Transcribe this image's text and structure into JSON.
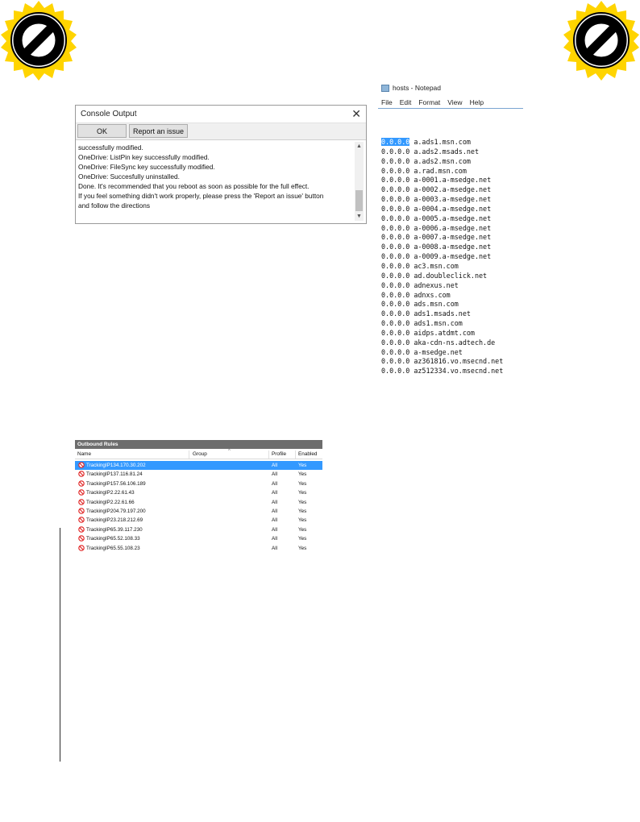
{
  "console": {
    "title": "Console Output",
    "close_label": "✕",
    "ok_label": "OK",
    "report_label": "Report an issue",
    "log": [
      "successfully modified.",
      "OneDrive: ListPin key successfully modified.",
      "OneDrive: FileSync key successfully modified.",
      "OneDrive: Succesfully uninstalled.",
      "Done. It's recommended that you reboot as soon as possible for the full effect.",
      "If you feel something didn't work properly, please press the 'Report an issue' button",
      "and follow the directions"
    ]
  },
  "notepad": {
    "title": "hosts - Notepad",
    "menu": [
      "File",
      "Edit",
      "Format",
      "View",
      "Help"
    ],
    "selected_ip": "0.0.0.0",
    "first_host": "a.ads1.msn.com",
    "entries": [
      "0.0.0.0 a.ads2.msads.net",
      "0.0.0.0 a.ads2.msn.com",
      "0.0.0.0 a.rad.msn.com",
      "0.0.0.0 a-0001.a-msedge.net",
      "0.0.0.0 a-0002.a-msedge.net",
      "0.0.0.0 a-0003.a-msedge.net",
      "0.0.0.0 a-0004.a-msedge.net",
      "0.0.0.0 a-0005.a-msedge.net",
      "0.0.0.0 a-0006.a-msedge.net",
      "0.0.0.0 a-0007.a-msedge.net",
      "0.0.0.0 a-0008.a-msedge.net",
      "0.0.0.0 a-0009.a-msedge.net",
      "0.0.0.0 ac3.msn.com",
      "0.0.0.0 ad.doubleclick.net",
      "0.0.0.0 adnexus.net",
      "0.0.0.0 adnxs.com",
      "0.0.0.0 ads.msn.com",
      "0.0.0.0 ads1.msads.net",
      "0.0.0.0 ads1.msn.com",
      "0.0.0.0 aidps.atdmt.com",
      "0.0.0.0 aka-cdn-ns.adtech.de",
      "0.0.0.0 a-msedge.net",
      "0.0.0.0 az361816.vo.msecnd.net",
      "0.0.0.0 az512334.vo.msecnd.net"
    ]
  },
  "rules": {
    "header": "Outbound Rules",
    "columns": {
      "name": "Name",
      "group": "Group",
      "profile": "Profile",
      "enabled": "Enabled"
    },
    "rows": [
      {
        "name": "TrackingIP134.170.30.202",
        "profile": "All",
        "enabled": "Yes"
      },
      {
        "name": "TrackingIP137.116.81.24",
        "profile": "All",
        "enabled": "Yes"
      },
      {
        "name": "TrackingIP157.56.106.189",
        "profile": "All",
        "enabled": "Yes"
      },
      {
        "name": "TrackingIP2.22.61.43",
        "profile": "All",
        "enabled": "Yes"
      },
      {
        "name": "TrackingIP2.22.61.66",
        "profile": "All",
        "enabled": "Yes"
      },
      {
        "name": "TrackingIP204.79.197.200",
        "profile": "All",
        "enabled": "Yes"
      },
      {
        "name": "TrackingIP23.218.212.69",
        "profile": "All",
        "enabled": "Yes"
      },
      {
        "name": "TrackingIP65.39.117.230",
        "profile": "All",
        "enabled": "Yes"
      },
      {
        "name": "TrackingIP65.52.108.33",
        "profile": "All",
        "enabled": "Yes"
      },
      {
        "name": "TrackingIP65.55.108.23",
        "profile": "All",
        "enabled": "Yes"
      }
    ]
  },
  "icons": {
    "badge": "prohibited-sign-icon",
    "rule": "block-icon",
    "notepad": "notepad-icon"
  },
  "colors": {
    "badge_fill": "#FFD400",
    "selection": "#3399ff",
    "block_red": "#e02020"
  }
}
